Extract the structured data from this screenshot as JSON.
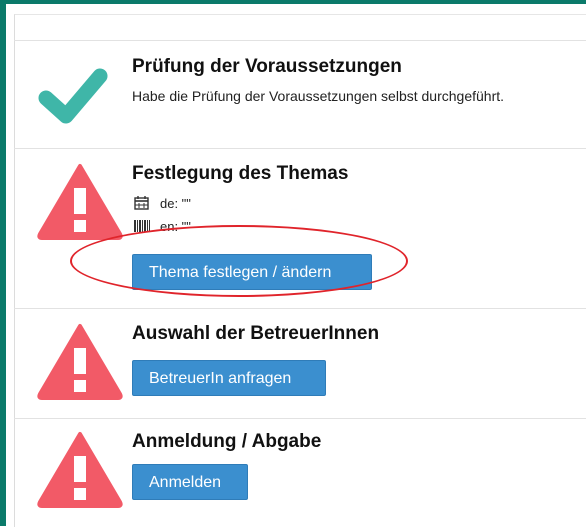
{
  "steps": [
    {
      "title": "Prüfung der Voraussetzungen",
      "description": "Habe die Prüfung der Voraussetzungen selbst durchgeführt.",
      "status": "done"
    },
    {
      "title": "Festlegung des Themas",
      "meta": [
        {
          "icon": "calendar-icon",
          "text": "de: \"\""
        },
        {
          "icon": "barcode-icon",
          "text": "en: \"\""
        }
      ],
      "button": "Thema festlegen / ändern",
      "status": "warning"
    },
    {
      "title": "Auswahl der BetreuerInnen",
      "button": "BetreuerIn anfragen",
      "status": "warning"
    },
    {
      "title": "Anmeldung / Abgabe",
      "button": "Anmelden",
      "status": "warning"
    }
  ],
  "colors": {
    "accent_border": "#0b7a6a",
    "check": "#3fb6a8",
    "warning": "#f25a67",
    "button": "#3b8fcf",
    "annotation": "#e0242b"
  }
}
